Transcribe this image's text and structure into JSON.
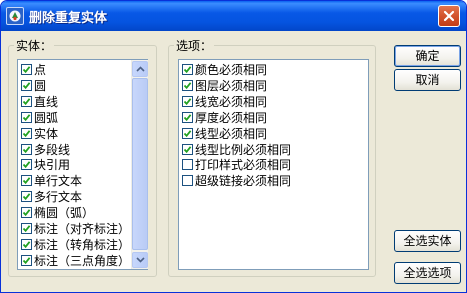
{
  "window": {
    "title": "删除重复实体"
  },
  "entities_group": {
    "label": "实体：",
    "items": [
      {
        "label": "点",
        "checked": true
      },
      {
        "label": "圆",
        "checked": true
      },
      {
        "label": "直线",
        "checked": true
      },
      {
        "label": "圆弧",
        "checked": true
      },
      {
        "label": "实体",
        "checked": true
      },
      {
        "label": "多段线",
        "checked": true
      },
      {
        "label": "块引用",
        "checked": true
      },
      {
        "label": "单行文本",
        "checked": true
      },
      {
        "label": "多行文本",
        "checked": true
      },
      {
        "label": "椭圆（弧）",
        "checked": true
      },
      {
        "label": "标注（对齐标注）",
        "checked": true
      },
      {
        "label": "标注（转角标注）",
        "checked": true
      },
      {
        "label": "标注（三点角度）",
        "checked": true
      }
    ]
  },
  "options_group": {
    "label": "选项：",
    "items": [
      {
        "label": "颜色必须相同",
        "checked": true
      },
      {
        "label": "图层必须相同",
        "checked": true
      },
      {
        "label": "线宽必须相同",
        "checked": true
      },
      {
        "label": "厚度必须相同",
        "checked": true
      },
      {
        "label": "线型必须相同",
        "checked": true
      },
      {
        "label": "线型比例必须相同",
        "checked": true
      },
      {
        "label": "打印样式必须相同",
        "checked": false
      },
      {
        "label": "超级链接必须相同",
        "checked": false
      }
    ]
  },
  "buttons": {
    "ok": "确定",
    "cancel": "取消",
    "select_all_entities": "全选实体",
    "select_all_options": "全选选项"
  }
}
